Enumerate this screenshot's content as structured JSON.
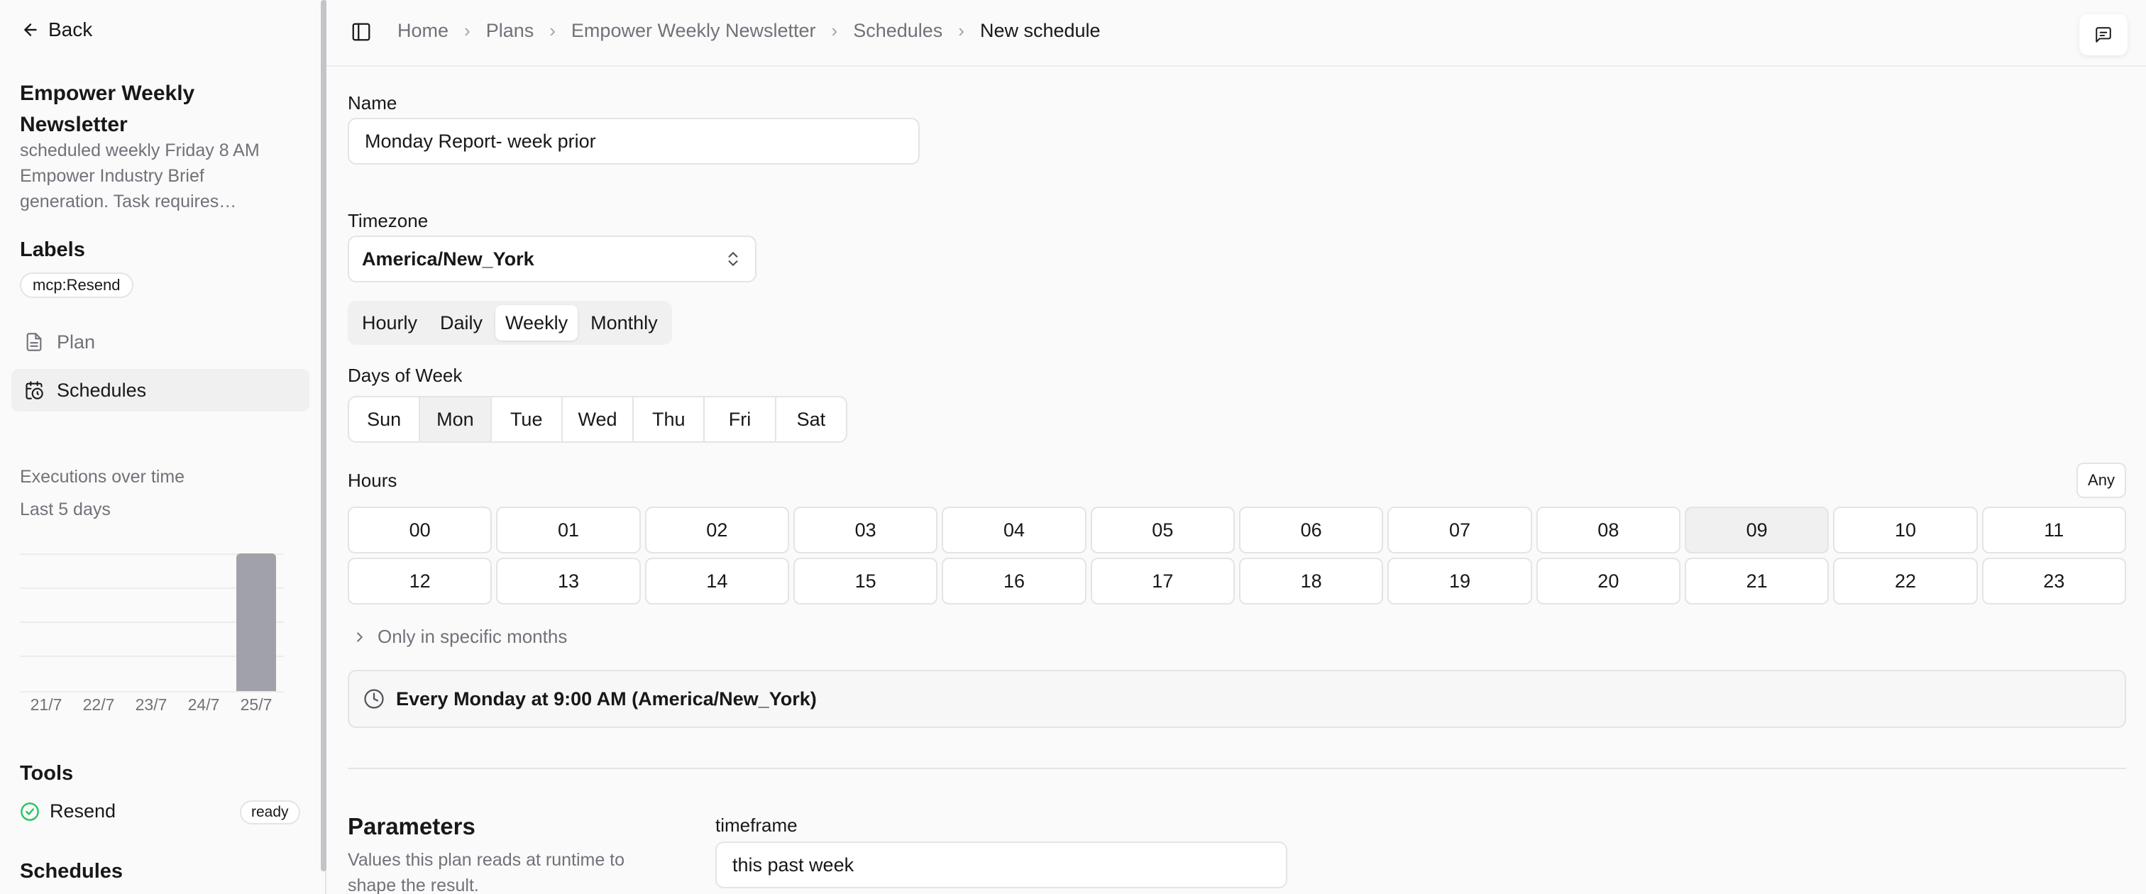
{
  "sidebar": {
    "back_label": "Back",
    "plan_title": "Empower Weekly Newsletter",
    "plan_description": "scheduled weekly Friday 8 AM Empower Industry Brief generation. Task requires…",
    "labels_heading": "Labels",
    "labels": [
      "mcp:Resend"
    ],
    "nav": [
      {
        "label": "Plan",
        "icon": "document-icon"
      },
      {
        "label": "Schedules",
        "icon": "calendar-clock-icon",
        "active": true
      }
    ],
    "chart_title": "Executions over time",
    "chart_subtitle": "Last 5 days",
    "tools_heading": "Tools",
    "tools": [
      {
        "name": "Resend",
        "status": "ready"
      }
    ],
    "schedules_heading": "Schedules"
  },
  "chart_data": {
    "type": "bar",
    "categories": [
      "21/7",
      "22/7",
      "23/7",
      "24/7",
      "25/7"
    ],
    "values": [
      0,
      0,
      0,
      0,
      1
    ],
    "ylim": [
      0,
      1
    ],
    "grid": true,
    "color": "#a1a1aa"
  },
  "breadcrumb": [
    "Home",
    "Plans",
    "Empower Weekly Newsletter",
    "Schedules",
    "New schedule"
  ],
  "form": {
    "name_label": "Name",
    "name_value": "Monday Report- week prior",
    "timezone_label": "Timezone",
    "timezone_value": "America/New_York",
    "frequency_options": [
      "Hourly",
      "Daily",
      "Weekly",
      "Monthly"
    ],
    "frequency_selected": "Weekly",
    "days_label": "Days of Week",
    "days": [
      "Sun",
      "Mon",
      "Tue",
      "Wed",
      "Thu",
      "Fri",
      "Sat"
    ],
    "days_selected": [
      "Mon"
    ],
    "hours_label": "Hours",
    "any_label": "Any",
    "hours": [
      "00",
      "01",
      "02",
      "03",
      "04",
      "05",
      "06",
      "07",
      "08",
      "09",
      "10",
      "11",
      "12",
      "13",
      "14",
      "15",
      "16",
      "17",
      "18",
      "19",
      "20",
      "21",
      "22",
      "23"
    ],
    "hours_selected": [
      "09"
    ],
    "months_toggle_label": "Only in specific months",
    "summary": "Every Monday at 9:00 AM (America/New_York)"
  },
  "parameters": {
    "heading": "Parameters",
    "description": "Values this plan reads at runtime to shape the result.",
    "fields": [
      {
        "name": "timeframe",
        "value": "this past week"
      }
    ]
  },
  "colors": {
    "success": "#22c55e",
    "border": "#e4e4e7",
    "muted_text": "#71717a"
  }
}
